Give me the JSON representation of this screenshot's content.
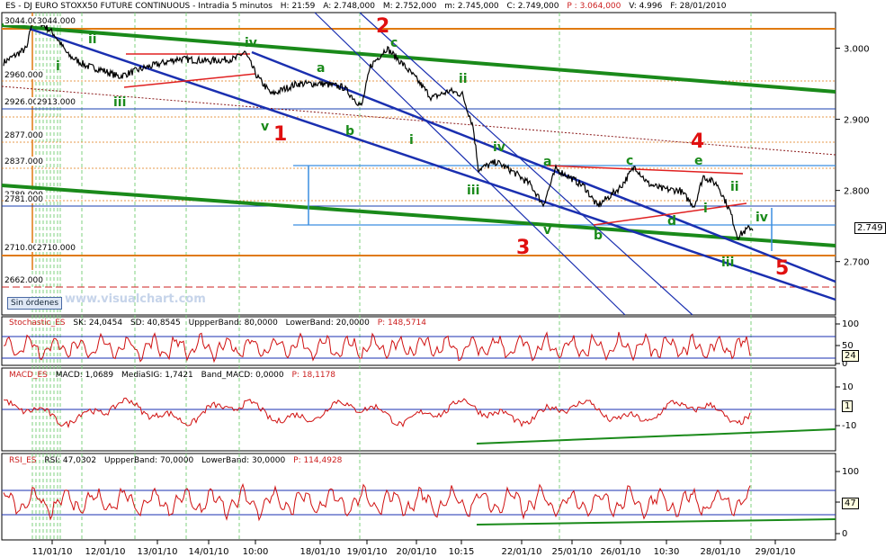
{
  "header": {
    "symbol": "ES - DJ EURO STOXX50 FUTURE CONTINUOUS - Intradia 5 minutos",
    "hour": "H: 21:59",
    "open": "A: 2.748,000",
    "high": "M: 2.752,000",
    "low": "m: 2.745,000",
    "close": "C: 2.749,000",
    "p": "P : 3.064,000",
    "v": "V: 4.996",
    "date": "F: 28/01/2010"
  },
  "price_axis": {
    "ticks": [
      "3.000",
      "2.900",
      "2.800",
      "2.700"
    ],
    "last_value": "2.749"
  },
  "levels": [
    {
      "label": "3044.000",
      "label2": "3044.000",
      "color": "#e07a10"
    },
    {
      "label": "2960.000",
      "color": "#e07a10"
    },
    {
      "label": "2926.000",
      "label2": "2913.000",
      "color": "#1a3fb0"
    },
    {
      "label": "2877.000",
      "color": "#e07a10"
    },
    {
      "label": "2837.000",
      "color": "#e07a10"
    },
    {
      "label": "2789.000",
      "color": "#e07a10"
    },
    {
      "label": "2781.000",
      "color": "#1a3fb0"
    },
    {
      "label": "2710.000",
      "label2": "2710.000",
      "color": "#e07a10"
    },
    {
      "label": "2662.000",
      "color": "#cc2020"
    }
  ],
  "wave_labels_green": [
    "i",
    "ii",
    "iii",
    "iv",
    "v",
    "a",
    "b",
    "c",
    "i",
    "ii",
    "iii",
    "iv",
    "v",
    "a",
    "b",
    "c",
    "d",
    "e",
    "i",
    "ii",
    "iii",
    "iv"
  ],
  "wave_labels_red": [
    "1",
    "2",
    "3",
    "4",
    "5"
  ],
  "sin_ordenes": "Sin órdenes",
  "watermark": "www.visualchart.com",
  "x_axis": [
    "11/01/10",
    "12/01/10",
    "13/01/10",
    "14/01/10",
    "10:00",
    "18/01/10",
    "19/01/10",
    "20/01/10",
    "10:15",
    "22/01/10",
    "25/01/10",
    "26/01/10",
    "10:30",
    "28/01/10",
    "29/01/10"
  ],
  "stochastic": {
    "title": "Stochastic_ES",
    "sk": "SK: 24,0454",
    "sd": "SD: 40,8545",
    "upper": "UppperBand: 80,0000",
    "lower": "LowerBand: 20,0000",
    "p": "P: 148,5714",
    "ticks": [
      "100",
      "50",
      "0"
    ],
    "last": "24"
  },
  "macd": {
    "title": "MACD_ES",
    "macd": "MACD: 1,0689",
    "signal": "MediaSIG: 1,7421",
    "band": "Band_MACD: 0,0000",
    "p": "P: 18,1178",
    "ticks": [
      "10",
      "-10"
    ],
    "last": "1"
  },
  "rsi": {
    "title": "RSI_ES",
    "rsi": "RSI: 47,0302",
    "upper": "UppperBand: 70,0000",
    "lower": "LowerBand: 30,0000",
    "p": "P: 114,4928",
    "ticks": [
      "100",
      "50",
      "0"
    ],
    "last": "47"
  },
  "chart_data": {
    "type": "line",
    "title": "ES - DJ EURO STOXX50 FUTURE CONTINUOUS - Intradia 5 minutos",
    "xlabel": "",
    "ylabel": "",
    "ylim": [
      2625,
      3050
    ],
    "categories": [
      "11/01/10",
      "12/01/10",
      "13/01/10",
      "14/01/10",
      "10:00",
      "18/01/10",
      "19/01/10",
      "20/01/10",
      "10:15",
      "22/01/10",
      "25/01/10",
      "26/01/10",
      "10:30",
      "28/01/10"
    ],
    "series": [
      {
        "values": [
          3030,
          2975,
          2960,
          2985,
          2960,
          2950,
          2935,
          2975,
          2905,
          2835,
          2815,
          2800,
          2790,
          2735
        ]
      }
    ],
    "colors": {
      "price": "#000000",
      "trend_green": "#1a8a1a",
      "channel_blue": "#1a2fb0",
      "level_orange": "#e07a10",
      "level_red": "#cc2020",
      "indicator": "#d01010"
    }
  }
}
